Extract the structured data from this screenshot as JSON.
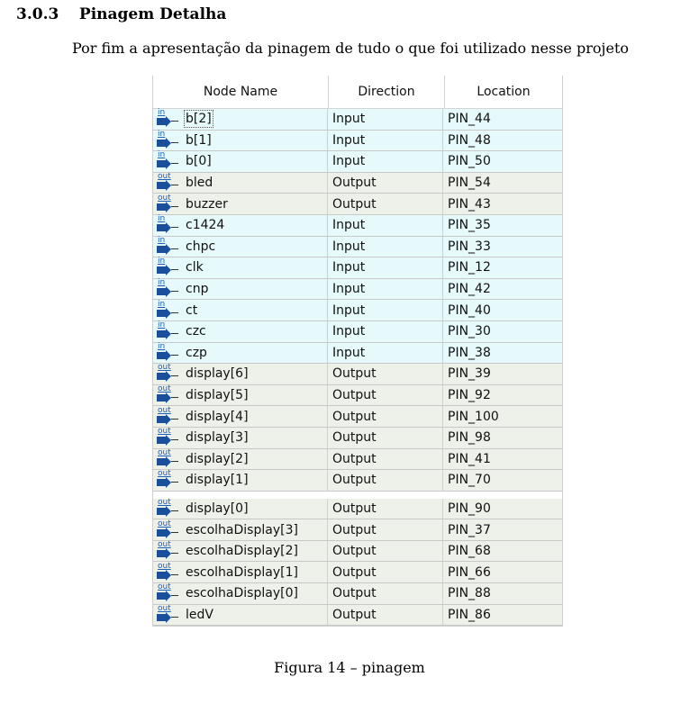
{
  "section": {
    "number": "3.0.3",
    "title": "Pinagem Detalha"
  },
  "intro": "Por fim a apresentação da pinagem de tudo o que foi utilizado nesse projeto",
  "table": {
    "headers": [
      "Node Name",
      "Direction",
      "Location"
    ],
    "rows": [
      {
        "icon": "in",
        "name": "b[2]",
        "direction": "Input",
        "location": "PIN_44"
      },
      {
        "icon": "in",
        "name": "b[1]",
        "direction": "Input",
        "location": "PIN_48"
      },
      {
        "icon": "in",
        "name": "b[0]",
        "direction": "Input",
        "location": "PIN_50"
      },
      {
        "icon": "out",
        "name": "bled",
        "direction": "Output",
        "location": "PIN_54"
      },
      {
        "icon": "out",
        "name": "buzzer",
        "direction": "Output",
        "location": "PIN_43"
      },
      {
        "icon": "in",
        "name": "c1424",
        "direction": "Input",
        "location": "PIN_35"
      },
      {
        "icon": "in",
        "name": "chpc",
        "direction": "Input",
        "location": "PIN_33"
      },
      {
        "icon": "in",
        "name": "clk",
        "direction": "Input",
        "location": "PIN_12"
      },
      {
        "icon": "in",
        "name": "cnp",
        "direction": "Input",
        "location": "PIN_42"
      },
      {
        "icon": "in",
        "name": "ct",
        "direction": "Input",
        "location": "PIN_40"
      },
      {
        "icon": "in",
        "name": "czc",
        "direction": "Input",
        "location": "PIN_30"
      },
      {
        "icon": "in",
        "name": "czp",
        "direction": "Input",
        "location": "PIN_38"
      },
      {
        "icon": "out",
        "name": "display[6]",
        "direction": "Output",
        "location": "PIN_39"
      },
      {
        "icon": "out",
        "name": "display[5]",
        "direction": "Output",
        "location": "PIN_92"
      },
      {
        "icon": "out",
        "name": "display[4]",
        "direction": "Output",
        "location": "PIN_100"
      },
      {
        "icon": "out",
        "name": "display[3]",
        "direction": "Output",
        "location": "PIN_98"
      },
      {
        "icon": "out",
        "name": "display[2]",
        "direction": "Output",
        "location": "PIN_41"
      },
      {
        "icon": "out",
        "name": "display[1]",
        "direction": "Output",
        "location": "PIN_70"
      },
      {
        "icon": "out",
        "name": "display[0]",
        "direction": "Output",
        "location": "PIN_90"
      },
      {
        "icon": "out",
        "name": "escolhaDisplay[3]",
        "direction": "Output",
        "location": "PIN_37"
      },
      {
        "icon": "out",
        "name": "escolhaDisplay[2]",
        "direction": "Output",
        "location": "PIN_68"
      },
      {
        "icon": "out",
        "name": "escolhaDisplay[1]",
        "direction": "Output",
        "location": "PIN_66"
      },
      {
        "icon": "out",
        "name": "escolhaDisplay[0]",
        "direction": "Output",
        "location": "PIN_88"
      },
      {
        "icon": "out",
        "name": "ledV",
        "direction": "Output",
        "location": "PIN_86"
      }
    ]
  },
  "caption": "Figura 14 – pinagem",
  "colors": {
    "input_row": "#e6f9fb",
    "output_row": "#eef0ea",
    "icon_arrow": "#1a4f9c"
  }
}
